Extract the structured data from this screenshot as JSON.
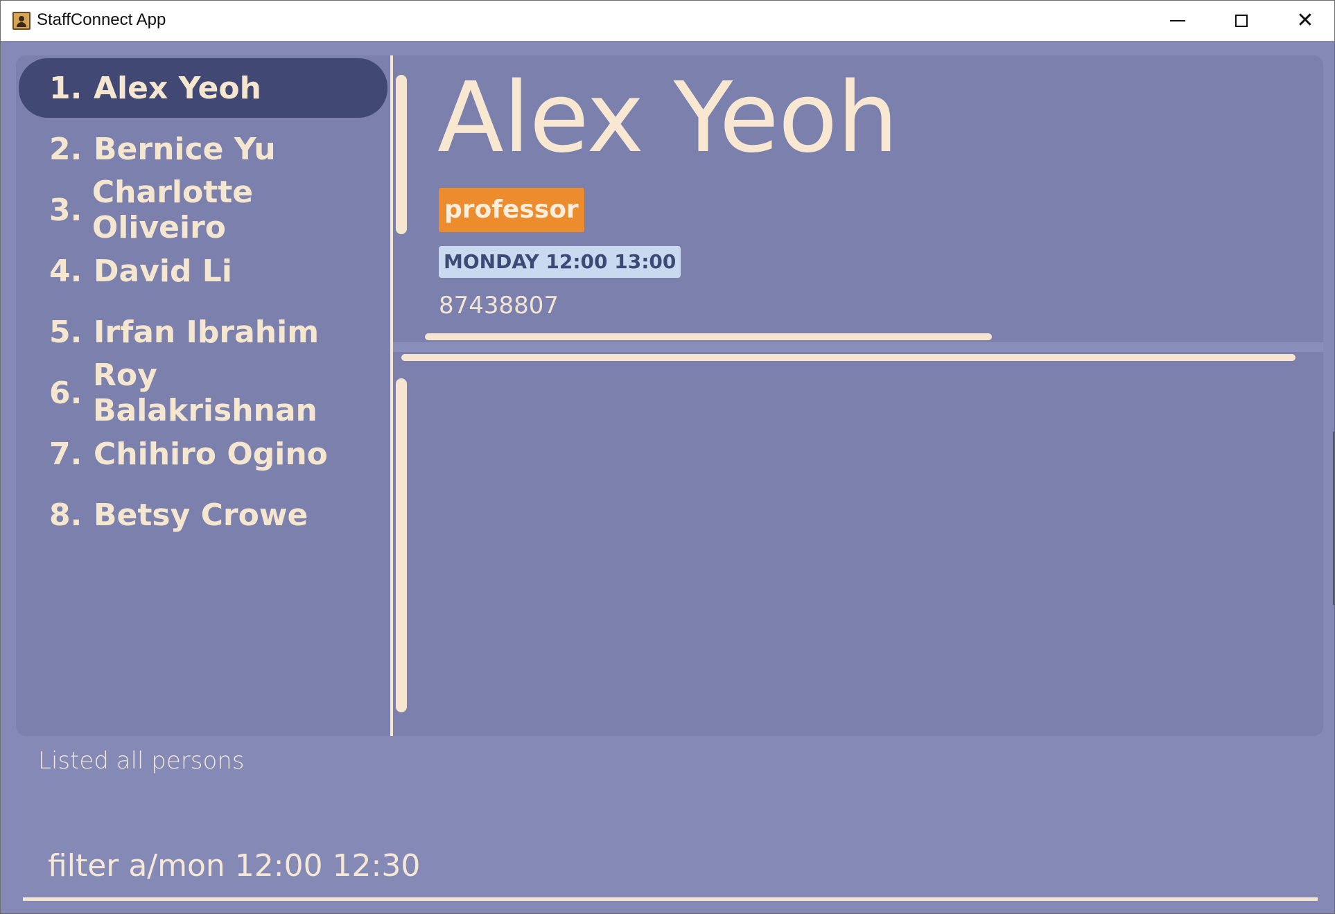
{
  "window": {
    "title": "StaffConnect App",
    "controls": [
      "minimize",
      "maximize",
      "close"
    ]
  },
  "person_list": {
    "selected_index": 0,
    "items": [
      {
        "index": "1.",
        "name": "Alex Yeoh"
      },
      {
        "index": "2.",
        "name": "Bernice Yu"
      },
      {
        "index": "3.",
        "name": "Charlotte Oliveiro"
      },
      {
        "index": "4.",
        "name": "David Li"
      },
      {
        "index": "5.",
        "name": "Irfan Ibrahim"
      },
      {
        "index": "6.",
        "name": "Roy Balakrishnan"
      },
      {
        "index": "7.",
        "name": "Chihiro Ogino"
      },
      {
        "index": "8.",
        "name": "Betsy Crowe"
      }
    ]
  },
  "detail": {
    "name": "Alex Yeoh",
    "tag": "professor",
    "availability": "MONDAY 12:00 13:00",
    "phone": "87438807"
  },
  "status": {
    "message": "Listed all persons"
  },
  "command": {
    "value": "filter a/mon 12:00 12:30"
  },
  "colors": {
    "background": "#8589b5",
    "panel": "#7c80ad",
    "selected": "#404873",
    "text": "#f5e6cf",
    "tag": "#ec8c2c",
    "availability_bg": "#c9daf0"
  }
}
